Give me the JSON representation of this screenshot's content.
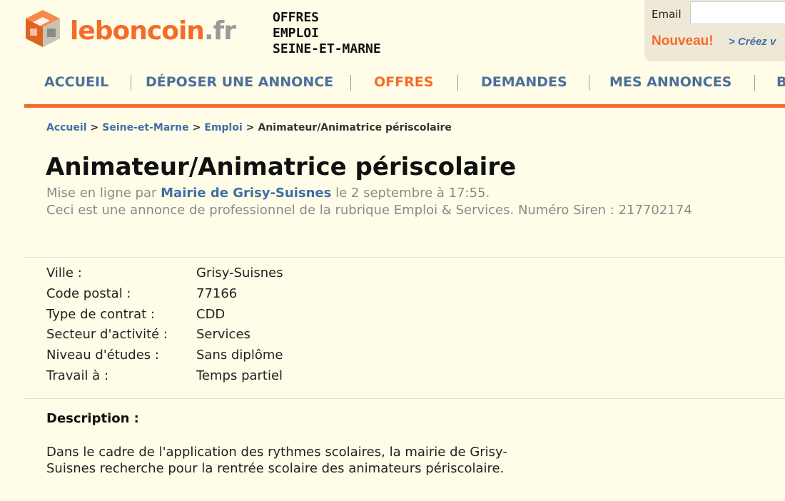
{
  "brand": {
    "logo_main": "leboncoin",
    "logo_tld": ".fr",
    "accent": "#f56b2a",
    "link": "#3f6fa6"
  },
  "header_category": [
    "OFFRES",
    "EMPLOI",
    "SEINE-ET-MARNE"
  ],
  "login": {
    "email_label": "Email",
    "email_value": "",
    "new_label": "Nouveau!",
    "create_label": "> Créez v"
  },
  "nav": {
    "items": [
      {
        "label": "ACCUEIL",
        "active": false
      },
      {
        "label": "DÉPOSER UNE ANNONCE",
        "active": false
      },
      {
        "label": "OFFRES",
        "active": true
      },
      {
        "label": "DEMANDES",
        "active": false
      },
      {
        "label": "MES ANNONCES",
        "active": false
      },
      {
        "label": "B",
        "active": false
      }
    ]
  },
  "breadcrumb": {
    "links": [
      "Accueil",
      "Seine-et-Marne",
      "Emploi"
    ],
    "current": "Animateur/Animatrice périscolaire",
    "separator": ">"
  },
  "ad": {
    "title": "Animateur/Animatrice périscolaire",
    "posted_prefix": "Mise en ligne par",
    "posted_by": "Mairie de Grisy-Suisnes",
    "posted_suffix": "le 2 septembre à 17:55.",
    "pro_notice": "Ceci est une annonce de professionnel de la rubrique Emploi & Services. Numéro Siren : 217702174",
    "details": [
      {
        "key": "Ville :",
        "value": "Grisy-Suisnes"
      },
      {
        "key": "Code postal :",
        "value": "77166"
      },
      {
        "key": "Type de contrat :",
        "value": "CDD"
      },
      {
        "key": "Secteur d'activité :",
        "value": "Services"
      },
      {
        "key": "Niveau d'études :",
        "value": "Sans diplôme"
      },
      {
        "key": "Travail à :",
        "value": "Temps partiel"
      }
    ],
    "description_label": "Description :",
    "description_text": "Dans le cadre de l'application des rythmes scolaires, la mairie de Grisy-Suisnes recherche pour la rentrée scolaire des animateurs périscolaire."
  }
}
